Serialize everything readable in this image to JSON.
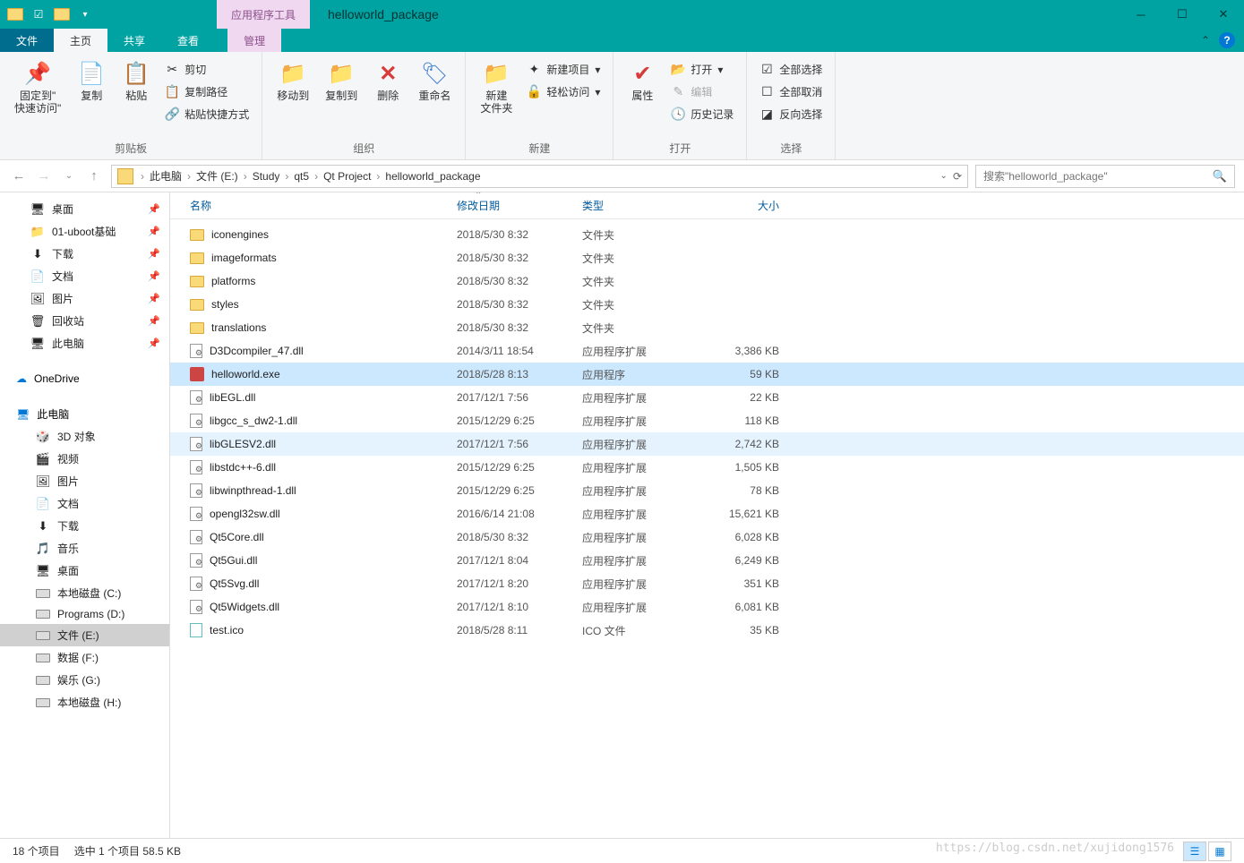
{
  "titlebar": {
    "tool_tab": "应用程序工具",
    "title": "helloworld_package"
  },
  "tabs": {
    "file": "文件",
    "home": "主页",
    "share": "共享",
    "view": "查看",
    "manage": "管理"
  },
  "ribbon": {
    "pin": "固定到\"\n快速访问\"",
    "copy": "复制",
    "paste": "粘贴",
    "cut": "剪切",
    "copy_path": "复制路径",
    "paste_shortcut": "粘贴快捷方式",
    "group_clipboard": "剪贴板",
    "move_to": "移动到",
    "copy_to": "复制到",
    "delete": "删除",
    "rename": "重命名",
    "group_org": "组织",
    "new_folder": "新建\n文件夹",
    "new_item": "新建项目",
    "easy_access": "轻松访问",
    "group_new": "新建",
    "properties": "属性",
    "open": "打开",
    "edit": "编辑",
    "history": "历史记录",
    "group_open": "打开",
    "select_all": "全部选择",
    "select_none": "全部取消",
    "invert": "反向选择",
    "group_select": "选择"
  },
  "breadcrumb": [
    "此电脑",
    "文件 (E:)",
    "Study",
    "qt5",
    "Qt Project",
    "helloworld_package"
  ],
  "search_placeholder": "搜索\"helloworld_package\"",
  "sidebar": {
    "quick": [
      "桌面",
      "01-uboot基础",
      "下载",
      "文档",
      "图片",
      "回收站",
      "此电脑"
    ],
    "onedrive": "OneDrive",
    "thispc": "此电脑",
    "thispc_items": [
      "3D 对象",
      "视频",
      "图片",
      "文档",
      "下载",
      "音乐",
      "桌面",
      "本地磁盘 (C:)",
      "Programs (D:)",
      "文件 (E:)",
      "数据 (F:)",
      "娱乐 (G:)",
      "本地磁盘 (H:)"
    ]
  },
  "columns": {
    "name": "名称",
    "date": "修改日期",
    "type": "类型",
    "size": "大小"
  },
  "files": [
    {
      "icon": "folder",
      "name": "iconengines",
      "date": "2018/5/30 8:32",
      "type": "文件夹",
      "size": ""
    },
    {
      "icon": "folder",
      "name": "imageformats",
      "date": "2018/5/30 8:32",
      "type": "文件夹",
      "size": ""
    },
    {
      "icon": "folder",
      "name": "platforms",
      "date": "2018/5/30 8:32",
      "type": "文件夹",
      "size": ""
    },
    {
      "icon": "folder",
      "name": "styles",
      "date": "2018/5/30 8:32",
      "type": "文件夹",
      "size": ""
    },
    {
      "icon": "folder",
      "name": "translations",
      "date": "2018/5/30 8:32",
      "type": "文件夹",
      "size": ""
    },
    {
      "icon": "dll",
      "name": "D3Dcompiler_47.dll",
      "date": "2014/3/11 18:54",
      "type": "应用程序扩展",
      "size": "3,386 KB"
    },
    {
      "icon": "exe",
      "name": "helloworld.exe",
      "date": "2018/5/28 8:13",
      "type": "应用程序",
      "size": "59 KB",
      "sel": true
    },
    {
      "icon": "dll",
      "name": "libEGL.dll",
      "date": "2017/12/1 7:56",
      "type": "应用程序扩展",
      "size": "22 KB"
    },
    {
      "icon": "dll",
      "name": "libgcc_s_dw2-1.dll",
      "date": "2015/12/29 6:25",
      "type": "应用程序扩展",
      "size": "118 KB"
    },
    {
      "icon": "dll",
      "name": "libGLESV2.dll",
      "date": "2017/12/1 7:56",
      "type": "应用程序扩展",
      "size": "2,742 KB",
      "hov": true
    },
    {
      "icon": "dll",
      "name": "libstdc++-6.dll",
      "date": "2015/12/29 6:25",
      "type": "应用程序扩展",
      "size": "1,505 KB"
    },
    {
      "icon": "dll",
      "name": "libwinpthread-1.dll",
      "date": "2015/12/29 6:25",
      "type": "应用程序扩展",
      "size": "78 KB"
    },
    {
      "icon": "dll",
      "name": "opengl32sw.dll",
      "date": "2016/6/14 21:08",
      "type": "应用程序扩展",
      "size": "15,621 KB"
    },
    {
      "icon": "dll",
      "name": "Qt5Core.dll",
      "date": "2018/5/30 8:32",
      "type": "应用程序扩展",
      "size": "6,028 KB"
    },
    {
      "icon": "dll",
      "name": "Qt5Gui.dll",
      "date": "2017/12/1 8:04",
      "type": "应用程序扩展",
      "size": "6,249 KB"
    },
    {
      "icon": "dll",
      "name": "Qt5Svg.dll",
      "date": "2017/12/1 8:20",
      "type": "应用程序扩展",
      "size": "351 KB"
    },
    {
      "icon": "dll",
      "name": "Qt5Widgets.dll",
      "date": "2017/12/1 8:10",
      "type": "应用程序扩展",
      "size": "6,081 KB"
    },
    {
      "icon": "ico",
      "name": "test.ico",
      "date": "2018/5/28 8:11",
      "type": "ICO 文件",
      "size": "35 KB"
    }
  ],
  "status": {
    "items": "18 个项目",
    "selected": "选中 1 个项目  58.5 KB",
    "watermark": "https://blog.csdn.net/xujidong1576"
  }
}
